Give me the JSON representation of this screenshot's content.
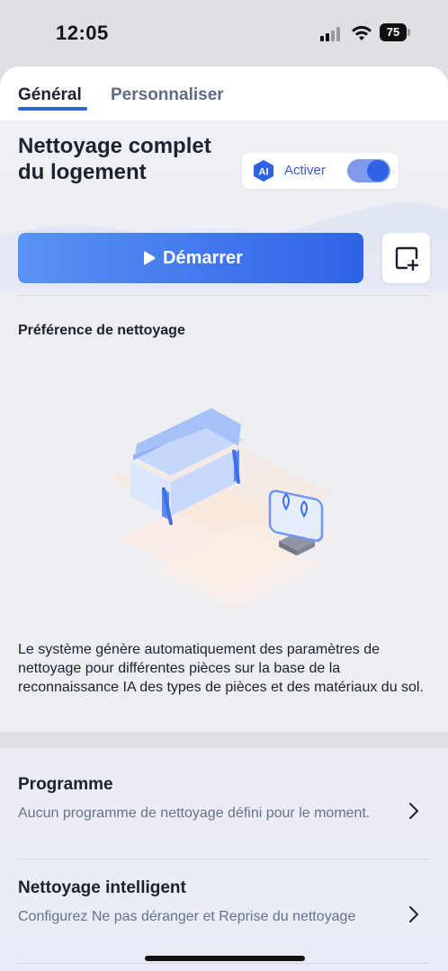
{
  "status_bar": {
    "time": "12:05",
    "battery": "75"
  },
  "tabs": [
    {
      "label": "Général",
      "active": true
    },
    {
      "label": "Personnaliser",
      "active": false
    }
  ],
  "header": {
    "title": "Nettoyage complet du logement"
  },
  "ai_toggle": {
    "badge": "AI",
    "label": "Activer",
    "enabled": true
  },
  "actions": {
    "start_label": "Démarrer",
    "start_icon": "play-icon",
    "add_icon": "add-square-icon"
  },
  "preference": {
    "label": "Préférence de nettoyage",
    "description": "Le système génère automatiquement des paramètres de nettoyage pour différentes pièces sur la base de la reconnaissance IA des types de pièces et des matériaux du sol."
  },
  "settings": [
    {
      "title": "Programme",
      "subtitle": "Aucun programme de nettoyage défini pour le moment."
    },
    {
      "title": "Nettoyage intelligent",
      "subtitle": "Configurez Ne pas déranger et Reprise du nettoyage"
    }
  ],
  "colors": {
    "accent": "#2e63e6",
    "accent_light": "#5a92f5",
    "toggle_track": "#7d9bea",
    "text_primary": "#1c2130",
    "text_secondary": "#66728a"
  }
}
